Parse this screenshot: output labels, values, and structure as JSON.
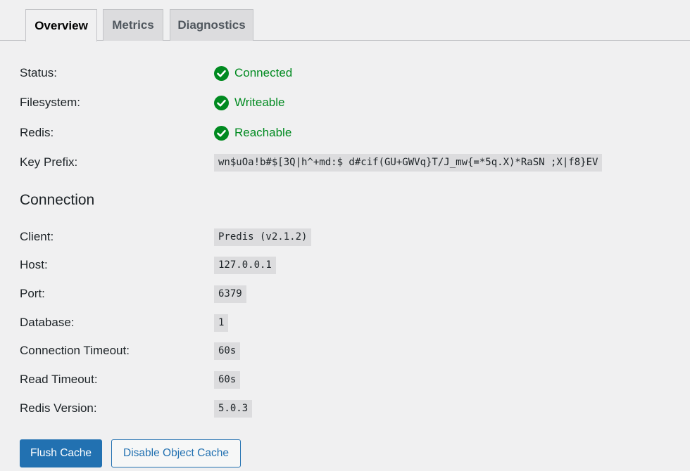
{
  "tabs": [
    {
      "label": "Overview",
      "active": true
    },
    {
      "label": "Metrics",
      "active": false
    },
    {
      "label": "Diagnostics",
      "active": false
    }
  ],
  "status": {
    "status_label": "Status:",
    "status_value": "Connected",
    "filesystem_label": "Filesystem:",
    "filesystem_value": "Writeable",
    "redis_label": "Redis:",
    "redis_value": "Reachable",
    "key_prefix_label": "Key Prefix:",
    "key_prefix_value": "wn$uOa!b#$[3Q|h^+md:$ d#cif(GU+GWVq}T/J_mw{=*5q.X)*RaSN ;X|f8}EV"
  },
  "connection": {
    "title": "Connection",
    "client_label": "Client:",
    "client_value": "Predis (v2.1.2)",
    "host_label": "Host:",
    "host_value": "127.0.0.1",
    "port_label": "Port:",
    "port_value": "6379",
    "database_label": "Database:",
    "database_value": "1",
    "connection_timeout_label": "Connection Timeout:",
    "connection_timeout_value": "60s",
    "read_timeout_label": "Read Timeout:",
    "read_timeout_value": "60s",
    "redis_version_label": "Redis Version:",
    "redis_version_value": "5.0.3"
  },
  "actions": {
    "flush_label": "Flush Cache",
    "disable_label": "Disable Object Cache"
  },
  "colors": {
    "success": "#008a20",
    "primary": "#2271b1",
    "background": "#f0f0f1"
  },
  "icons": {
    "status_ok": "check-circle-icon"
  }
}
